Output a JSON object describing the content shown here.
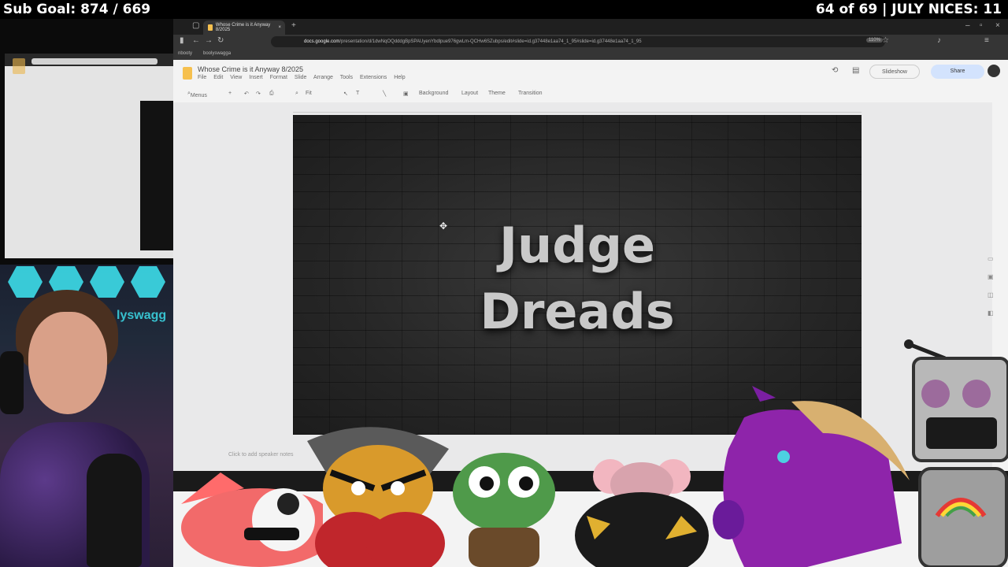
{
  "overlay": {
    "sub_goal": "Sub Goal: 874 / 669",
    "top_right": "64 of 69 | JULY NICES: 11"
  },
  "browser": {
    "tab_title": "Whose Crime is it Anyway 8/2025",
    "url_host": "docs.google.com",
    "url_path": "/presentation/d/1dwNqOQdddgBpSPAUyenYbdlpue976gwLm-QCHw6SZubps/edit#slide=id.g37448e1aa74_1_95#slide=id.g37448e1aa74_1_95",
    "zoom": "110%",
    "bookmarks": [
      "nbooty",
      "boolyswagga"
    ]
  },
  "slides": {
    "doc_title": "Whose Crime is it Anyway 8/2025",
    "menus": [
      "File",
      "Edit",
      "View",
      "Insert",
      "Format",
      "Slide",
      "Arrange",
      "Tools",
      "Extensions",
      "Help"
    ],
    "slideshow_label": "Slideshow",
    "share_label": "Share",
    "toolbar": {
      "menus": "Menus",
      "fit": "Fit",
      "background": "Background",
      "layout": "Layout",
      "theme": "Theme",
      "transition": "Transition"
    },
    "slide_title": "Judge\nDreads",
    "speaker_notes_placeholder": "Click to add speaker notes"
  },
  "webcam": {
    "sign_text": "lyswagg"
  },
  "colors": {
    "accent": "#f6c04e",
    "share_bg": "#d3e3fd",
    "hex_light": "#3ee7f4"
  }
}
